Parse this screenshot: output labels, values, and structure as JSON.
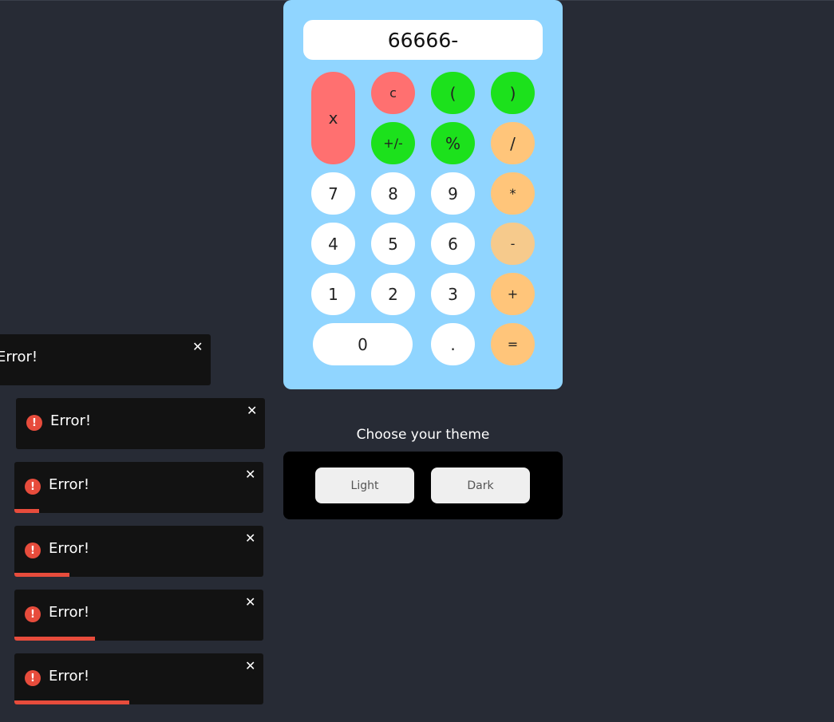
{
  "calculator": {
    "display": "66666-",
    "keys": {
      "clear_all": "x",
      "clear": "c",
      "open_paren": "(",
      "close_paren": ")",
      "toggle_sign": "+/-",
      "percent": "%",
      "divide": "/",
      "seven": "7",
      "eight": "8",
      "nine": "9",
      "multiply": "*",
      "four": "4",
      "five": "5",
      "six": "6",
      "subtract": "-",
      "one": "1",
      "two": "2",
      "three": "3",
      "add": "+",
      "zero": "0",
      "decimal": ".",
      "equals": "="
    }
  },
  "theme": {
    "title": "Choose your theme",
    "light_label": "Light",
    "dark_label": "Dark"
  },
  "toasts": [
    {
      "message": "Error!",
      "close": "✕",
      "progress": null
    },
    {
      "message": "Error!",
      "close": "✕",
      "icon": "!",
      "progress": null
    },
    {
      "message": "Error!",
      "close": "✕",
      "icon": "!",
      "progress": 0.1
    },
    {
      "message": "Error!",
      "close": "✕",
      "icon": "!",
      "progress": 0.22
    },
    {
      "message": "Error!",
      "close": "✕",
      "icon": "!",
      "progress": 0.325
    },
    {
      "message": "Error!",
      "close": "✕",
      "icon": "!",
      "progress": 0.46
    }
  ],
  "colors": {
    "background": "#272b35",
    "calculator_body": "#90d5ff",
    "key_white": "#ffffff",
    "key_red": "#ff7070",
    "key_green": "#1ce11c",
    "key_orange": "#ffc57a",
    "toast_background": "#121212",
    "error_red": "#e74c3c"
  },
  "icons": {
    "error": "error-icon",
    "close": "close-icon"
  }
}
